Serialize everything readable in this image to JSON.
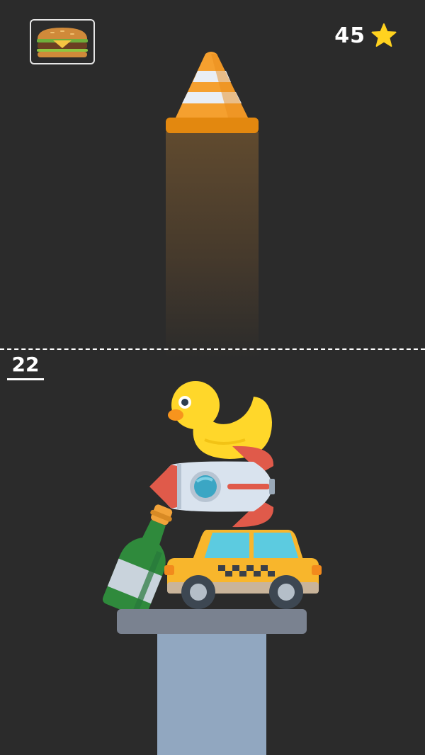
{
  "hud": {
    "stars_count": "45",
    "next_item_icon": "burger-icon",
    "star_icon": "star-icon"
  },
  "game": {
    "height_marker": "22",
    "falling_item": "traffic-cone",
    "stacked_items": [
      "rubber-duck",
      "rocket",
      "green-bottle",
      "taxi-car"
    ],
    "colors": {
      "background": "#2b2b2b",
      "star": "#ffd21f",
      "cone_orange": "#f5a02f",
      "duck_yellow": "#ffd72a",
      "taxi_yellow": "#f8b62c",
      "pedestal_top": "#7a8290",
      "pedestal_column": "#91a7c0"
    }
  }
}
